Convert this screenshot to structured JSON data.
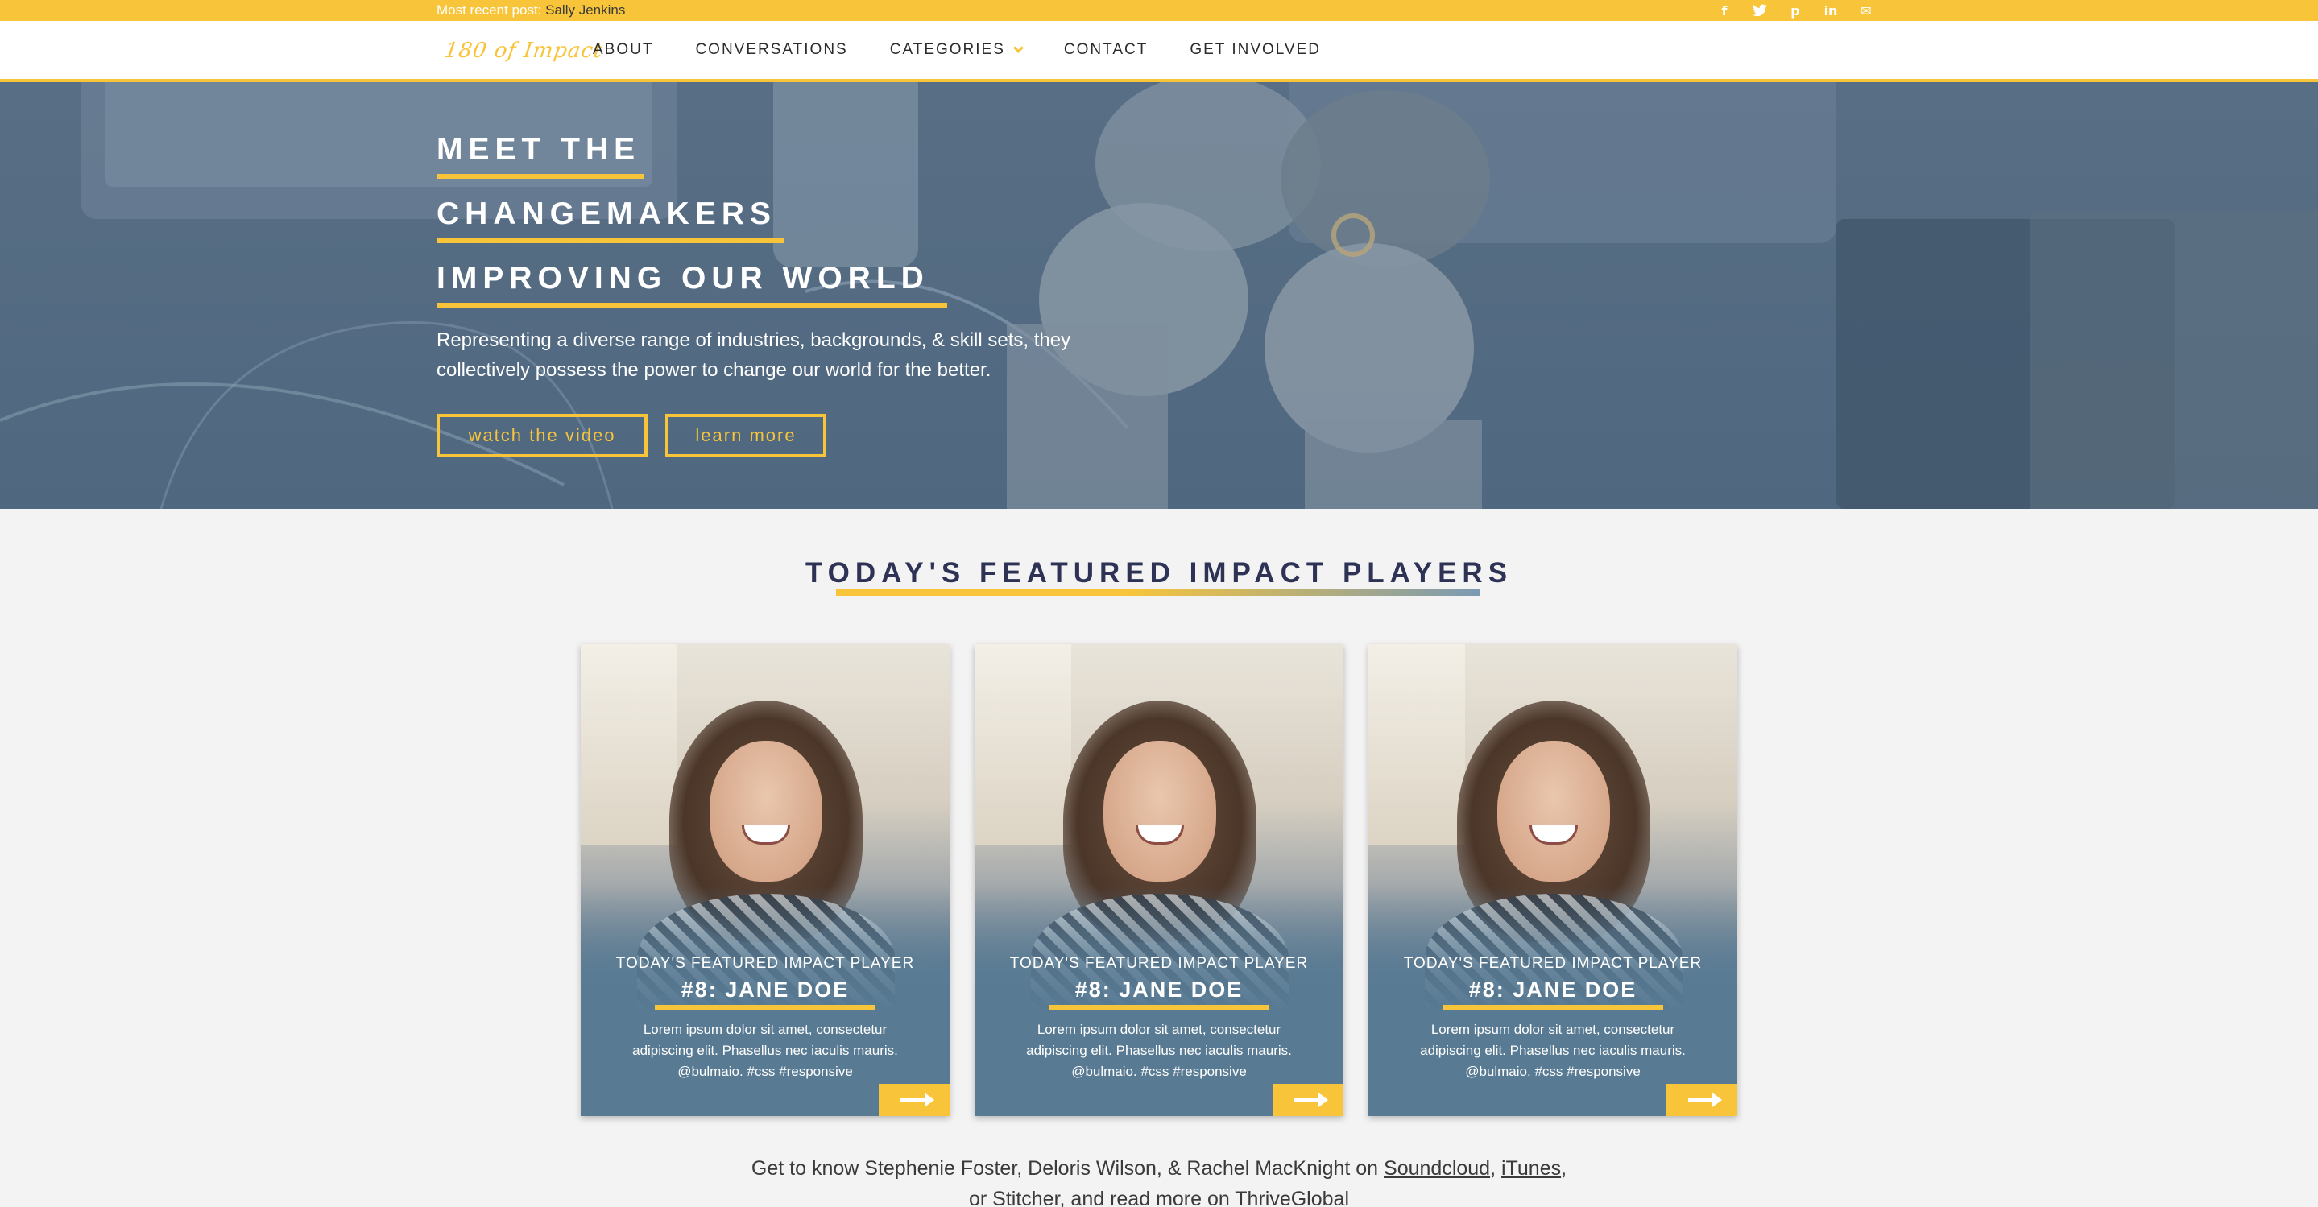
{
  "topbar": {
    "recent_label": "Most recent post:",
    "recent_name": "Sally Jenkins",
    "socials": [
      {
        "icon": "facebook-icon",
        "glyph": "f"
      },
      {
        "icon": "twitter-icon",
        "glyph": "🐦"
      },
      {
        "icon": "pinterest-icon",
        "glyph": "p"
      },
      {
        "icon": "linkedin-icon",
        "glyph": "in"
      },
      {
        "icon": "mail-icon",
        "glyph": "✉"
      }
    ]
  },
  "nav": {
    "logo": "180 of Impact",
    "items": [
      "ABOUT",
      "CONVERSATIONS",
      "CATEGORIES",
      "CONTACT",
      "GET INVOLVED"
    ]
  },
  "hero": {
    "line1": "MEET THE",
    "line2": "CHANGEMAKERS",
    "line3": "IMPROVING OUR WORLD",
    "description": "Representing a diverse range of industries, backgrounds, & skill sets, they collectively possess the power to change our world for the better.",
    "button_video": "watch the video",
    "button_learn": "learn more"
  },
  "featured": {
    "title": "TODAY'S FEATURED IMPACT PLAYERS",
    "cards": [
      {
        "kicker": "TODAY'S FEATURED IMPACT PLAYER",
        "name": "#8: JANE DOE",
        "description": "Lorem ipsum dolor sit amet, consectetur adipiscing elit. Phasellus nec iaculis mauris. @bulmaio. #css #responsive"
      },
      {
        "kicker": "TODAY'S FEATURED IMPACT PLAYER",
        "name": "#8: JANE DOE",
        "description": "Lorem ipsum dolor sit amet, consectetur adipiscing elit. Phasellus nec iaculis mauris. @bulmaio. #css #responsive"
      },
      {
        "kicker": "TODAY'S FEATURED IMPACT PLAYER",
        "name": "#8: JANE DOE",
        "description": "Lorem ipsum dolor sit amet, consectetur adipiscing elit. Phasellus nec iaculis mauris. @bulmaio. #css #responsive"
      }
    ]
  },
  "bottom": {
    "intro": "Get to know Stephenie Foster, Deloris Wilson, & Rachel MacKnight on",
    "link_soundcloud": "Soundcloud",
    "sep1": ",",
    "link_itunes": "iTunes",
    "sep2": ",",
    "line2": "or Stitcher, and read more on ThriveGlobal"
  },
  "colors": {
    "accent": "#f8c53a",
    "hero_overlay": "#546d84",
    "card_bg": "#587a93",
    "heading": "#2e3356"
  }
}
